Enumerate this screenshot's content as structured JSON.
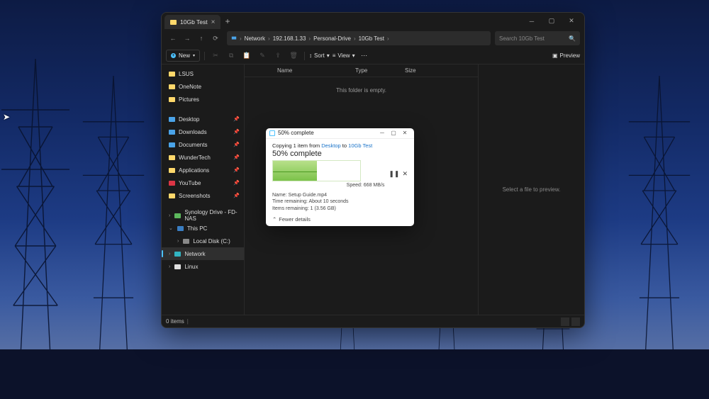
{
  "explorer": {
    "tab_title": "10Gb Test",
    "breadcrumb": [
      "Network",
      "192.168.1.33",
      "Personal-Drive",
      "10Gb Test"
    ],
    "search_placeholder": "Search 10Gb Test",
    "toolbar": {
      "new": "New",
      "sort": "Sort",
      "view": "View",
      "preview": "Preview"
    },
    "sidebar": {
      "top": [
        "LSUS",
        "OneNote",
        "Pictures"
      ],
      "pinned": [
        "Desktop",
        "Downloads",
        "Documents",
        "WunderTech",
        "Applications",
        "YouTube",
        "Screenshots"
      ],
      "bottom": [
        {
          "label": "Synology Drive - FD-NAS",
          "icon": "grn"
        },
        {
          "label": "This PC",
          "icon": "pc",
          "expanded": true
        },
        {
          "label": "Local Disk (C:)",
          "icon": "disk",
          "indent": true
        },
        {
          "label": "Network",
          "icon": "net",
          "selected": true
        },
        {
          "label": "Linux",
          "icon": "lin"
        }
      ]
    },
    "columns": [
      "Name",
      "Type",
      "Size"
    ],
    "empty_text": "This folder is empty.",
    "preview_text": "Select a file to preview.",
    "status": "0 items"
  },
  "dialog": {
    "title": "50% complete",
    "copying": {
      "pre": "Copying 1 item from ",
      "from": "Desktop",
      "mid": " to ",
      "to": "10Gb Test"
    },
    "heading": "50% complete",
    "speed": "Speed: 668 MB/s",
    "progress_pct": 50,
    "name": "Name: Setup Guide.mp4",
    "time": "Time remaining: About 10 seconds",
    "items": "Items remaining: 1 (3.56 GB)",
    "fewer": "Fewer details"
  }
}
